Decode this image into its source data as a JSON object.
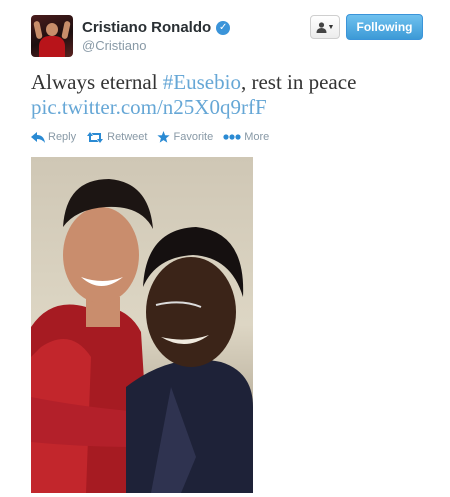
{
  "user": {
    "display_name": "Cristiano Ronaldo",
    "screen_name": "@Cristiano",
    "verified_icon": "verified-badge-icon",
    "avatar_icon": "profile-avatar"
  },
  "header_actions": {
    "user_menu_icon": "person-icon",
    "follow_label": "Following"
  },
  "tweet": {
    "text_before": "Always eternal ",
    "hashtag": "#Eusebio",
    "text_after": ", rest in peace",
    "link": "pic.twitter.com/n25X0q9rfF"
  },
  "actions": [
    {
      "label": "Reply",
      "icon": "reply-arrow-icon"
    },
    {
      "label": "Retweet",
      "icon": "retweet-icon"
    },
    {
      "label": "Favorite",
      "icon": "star-icon"
    },
    {
      "label": "More",
      "icon": "more-dots-icon"
    }
  ],
  "colors": {
    "link": "#66a7d6",
    "action_icon": "#2a8ad3",
    "muted": "#8899a6",
    "follow_button": "#3c9ad6",
    "verified": "#3b94d9"
  }
}
